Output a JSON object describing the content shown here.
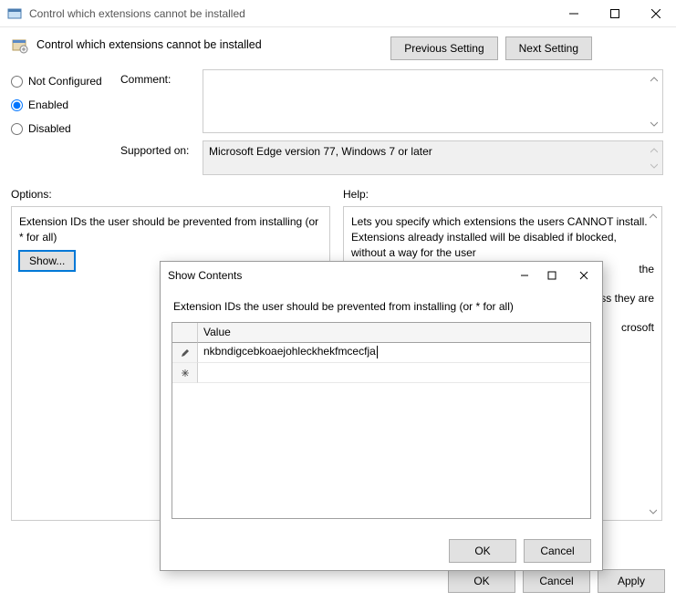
{
  "window": {
    "title": "Control which extensions cannot be installed"
  },
  "header": {
    "policy_title": "Control which extensions cannot be installed",
    "prev_setting": "Previous Setting",
    "next_setting": "Next Setting"
  },
  "state_radios": {
    "not_configured": "Not Configured",
    "enabled": "Enabled",
    "disabled": "Disabled",
    "selected": "enabled"
  },
  "fields": {
    "comment_label": "Comment:",
    "comment_value": "",
    "supported_label": "Supported on:",
    "supported_value": "Microsoft Edge version 77, Windows 7 or later"
  },
  "sections": {
    "options_label": "Options:",
    "help_label": "Help:"
  },
  "options_panel": {
    "list_label": "Extension IDs the user should be prevented from installing (or * for all)",
    "show_button": "Show..."
  },
  "help_panel": {
    "line1": "Lets you specify which extensions the users CANNOT install. Extensions already installed will be disabled if blocked, without a way for the user",
    "frag_the": "the",
    "frag_ess": "ss they are",
    "frag_soft": "crosoft"
  },
  "buttons": {
    "ok": "OK",
    "cancel": "Cancel",
    "apply": "Apply"
  },
  "dialog": {
    "title": "Show Contents",
    "subtitle": "Extension IDs the user should be prevented from installing (or * for all)",
    "column_header": "Value",
    "rows": [
      {
        "value": "nkbndigcebkoaejohleckhekfmcecfja",
        "editing": true
      },
      {
        "value": "",
        "editing": false
      }
    ],
    "ok": "OK",
    "cancel": "Cancel"
  }
}
